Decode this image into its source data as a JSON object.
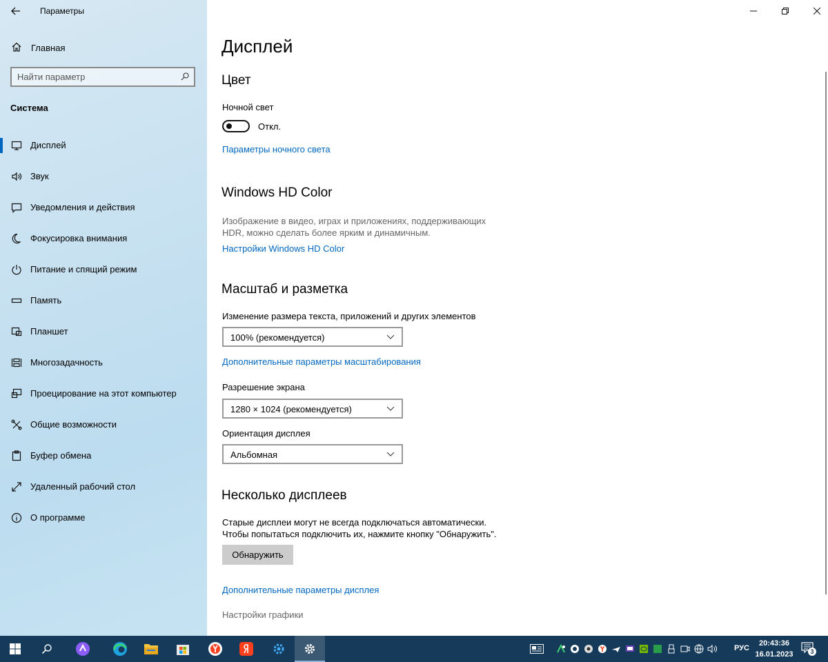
{
  "window": {
    "title": "Параметры"
  },
  "sidebar": {
    "home_label": "Главная",
    "search_placeholder": "Найти параметр",
    "section": "Система",
    "items": [
      {
        "label": "Дисплей",
        "icon": "monitor-icon",
        "active": true
      },
      {
        "label": "Звук",
        "icon": "speaker-icon"
      },
      {
        "label": "Уведомления и действия",
        "icon": "notification-icon"
      },
      {
        "label": "Фокусировка внимания",
        "icon": "moon-icon"
      },
      {
        "label": "Питание и спящий режим",
        "icon": "power-icon"
      },
      {
        "label": "Память",
        "icon": "storage-icon"
      },
      {
        "label": "Планшет",
        "icon": "tablet-icon"
      },
      {
        "label": "Многозадачность",
        "icon": "multitasking-icon"
      },
      {
        "label": "Проецирование на этот компьютер",
        "icon": "projection-icon"
      },
      {
        "label": "Общие возможности",
        "icon": "shared-experiences-icon"
      },
      {
        "label": "Буфер обмена",
        "icon": "clipboard-icon"
      },
      {
        "label": "Удаленный рабочий стол",
        "icon": "remote-desktop-icon"
      },
      {
        "label": "О программе",
        "icon": "info-icon"
      }
    ]
  },
  "main": {
    "page_title": "Дисплей",
    "color": {
      "heading": "Цвет",
      "night_light_label": "Ночной свет",
      "night_light_state": "Откл.",
      "night_light_settings_link": "Параметры ночного света"
    },
    "hdr": {
      "heading": "Windows HD Color",
      "description": "Изображение в видео, играх и приложениях, поддерживающих HDR, можно сделать более ярким и динамичным.",
      "link": "Настройки Windows HD Color"
    },
    "scale": {
      "heading": "Масштаб и разметка",
      "scale_label": "Изменение размера текста, приложений и других элементов",
      "scale_value": "100% (рекомендуется)",
      "advanced_link": "Дополнительные параметры масштабирования",
      "resolution_label": "Разрешение экрана",
      "resolution_value": "1280 × 1024 (рекомендуется)",
      "orientation_label": "Ориентация дисплея",
      "orientation_value": "Альбомная"
    },
    "multi": {
      "heading": "Несколько дисплеев",
      "description_line1": "Старые дисплеи могут не всегда подключаться автоматически.",
      "description_line2": "Чтобы попытаться подключить их, нажмите кнопку \"Обнаружить\".",
      "detect_button": "Обнаружить",
      "advanced_display_link": "Дополнительные параметры дисплея",
      "graphics_settings": "Настройки графики"
    }
  },
  "taskbar": {
    "language": "РУС",
    "time": "20:43:36",
    "date": "16.01.2023",
    "notification_count": "3",
    "colors": {
      "background": "#163a5a",
      "active": "#3c5973",
      "accent": "#0067c0"
    }
  }
}
